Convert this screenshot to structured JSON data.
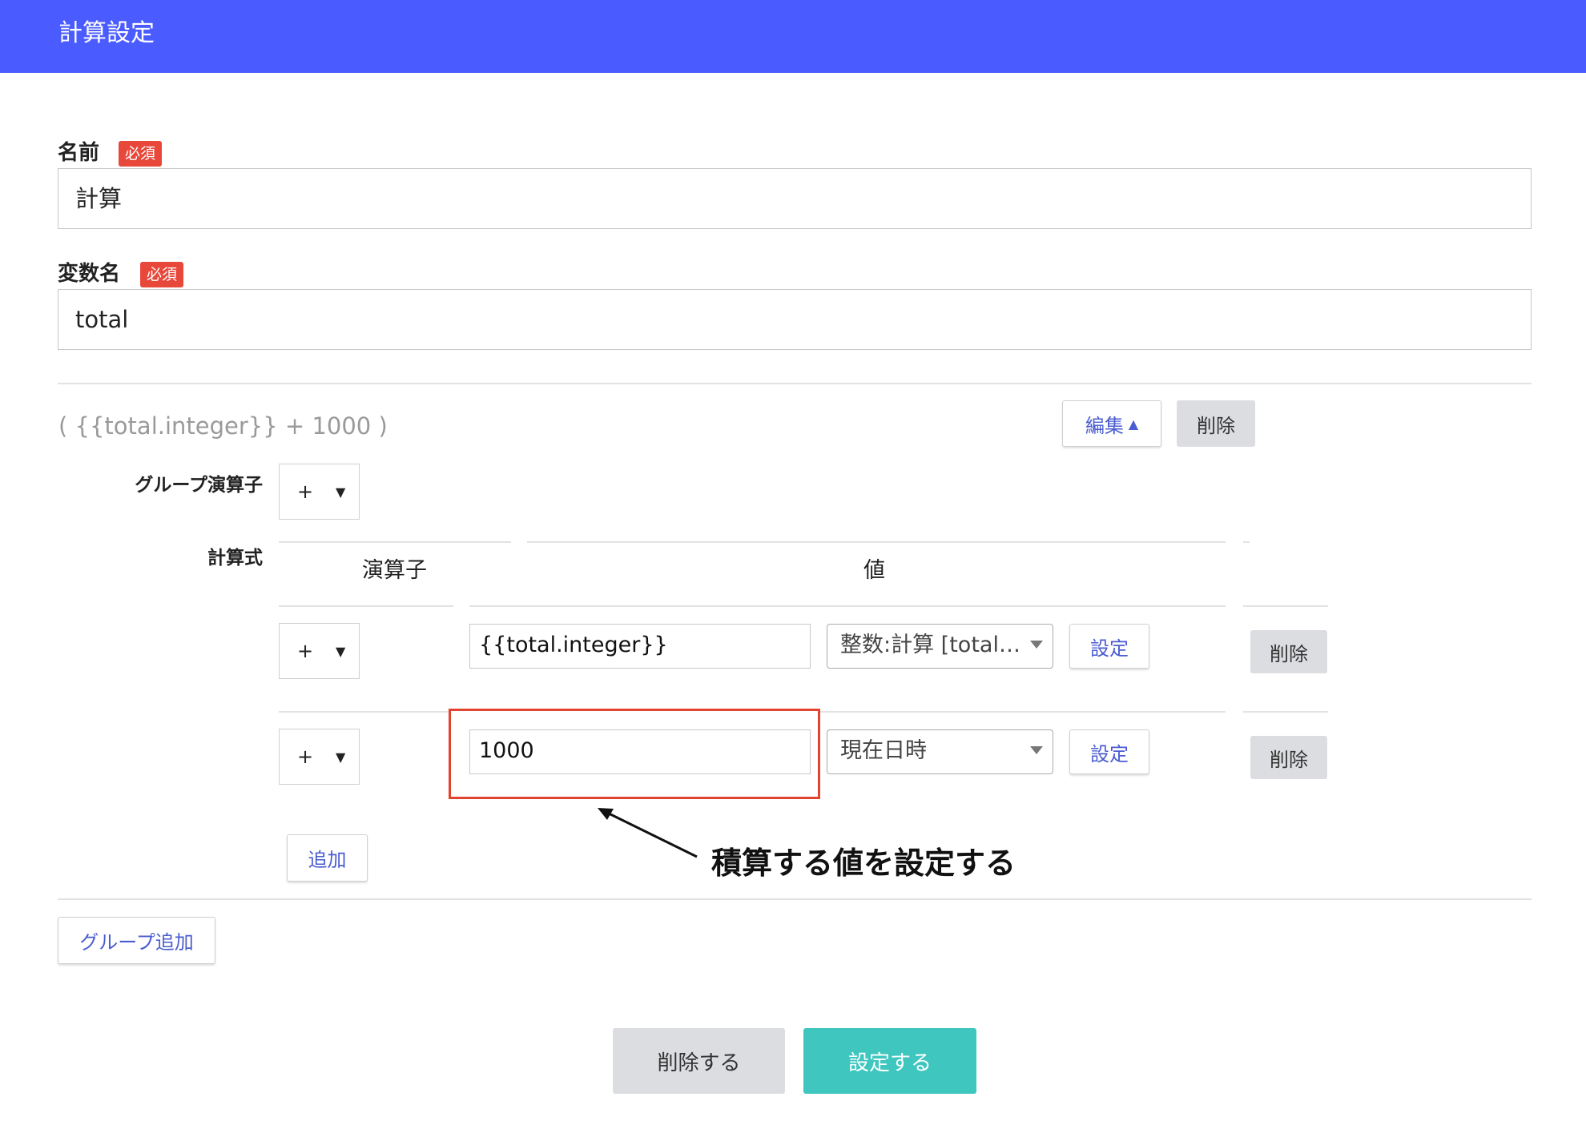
{
  "header": {
    "title": "計算設定"
  },
  "name_field": {
    "label": "名前",
    "required_badge": "必須",
    "value": "計算"
  },
  "variable_field": {
    "label": "変数名",
    "required_badge": "必須",
    "value": "total"
  },
  "group": {
    "expression_summary": "( {{total.integer}} + 1000 )",
    "edit_label": "編集",
    "edit_icon": "▲",
    "delete_label": "削除",
    "group_operator_label": "グループ演算子",
    "group_operator_value": "+",
    "formula_label": "計算式",
    "columns": {
      "operator": "演算子",
      "value": "値"
    },
    "rows": [
      {
        "operator": "+",
        "value": "{{total.integer}}",
        "type": "整数:計算 [total.integer]",
        "set_label": "設定",
        "delete_label": "削除"
      },
      {
        "operator": "+",
        "value": "1000",
        "type": "現在日時",
        "set_label": "設定",
        "delete_label": "削除"
      }
    ],
    "add_label": "追加"
  },
  "add_group_label": "グループ追加",
  "footer": {
    "delete_label": "削除する",
    "submit_label": "設定する"
  },
  "annotation": {
    "text": "積算する値を設定する"
  },
  "colors": {
    "header": "#4a5cff",
    "required": "#e8483a",
    "primary": "#3ec6bf",
    "highlight": "#e2452f",
    "link": "#4a5cd0"
  }
}
